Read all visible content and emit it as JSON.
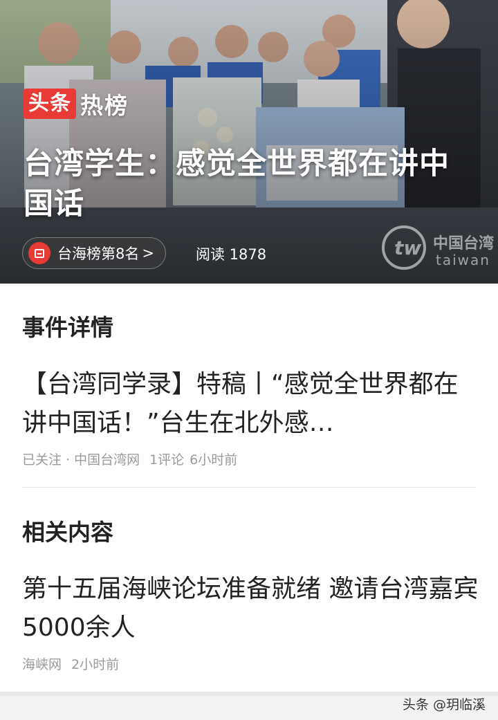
{
  "hero": {
    "brand": {
      "box_label": "头条",
      "text": "热榜"
    },
    "title": "台湾学生：感觉全世界都在讲中国话",
    "rank_label": "台海榜第8名",
    "rank_chevron": ">",
    "read_label": "阅读 1878",
    "source_watermark": {
      "mark": "tw",
      "cn": "中国台湾",
      "en": "taiwan"
    }
  },
  "event_details": {
    "section_title": "事件详情",
    "article": {
      "title": "【台湾同学录】特稿丨“感觉全世界都在讲中国话！”台生在北外感…",
      "meta": {
        "follow": "已关注",
        "separator": "·",
        "source": "中国台湾网",
        "comments": "1评论",
        "time": "6小时前"
      }
    }
  },
  "related": {
    "section_title": "相关内容",
    "article": {
      "title": "第十五届海峡论坛准备就绪 邀请台湾嘉宾5000余人",
      "meta": {
        "source": "海峡网",
        "time": "2小时前"
      }
    }
  },
  "account_watermark": "头条 @玥临溪",
  "colors": {
    "brand_red": "#e83b36",
    "text_primary": "#222222",
    "text_meta": "#9a9a9a",
    "divider": "#e6e6e6"
  },
  "icons": [
    "rank-list-icon",
    "chevron-right-icon"
  ]
}
